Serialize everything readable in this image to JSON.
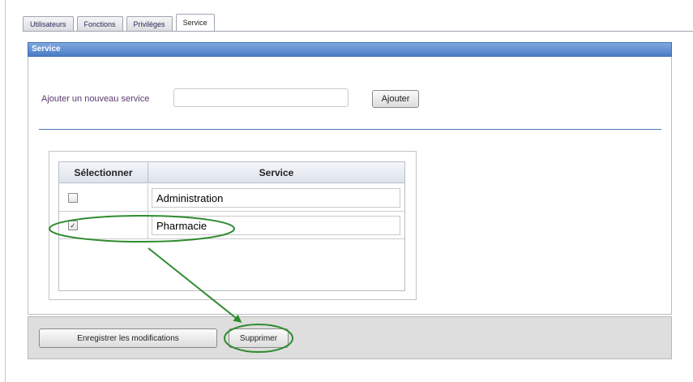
{
  "tabs": [
    {
      "label": "Utilisateurs",
      "active": false
    },
    {
      "label": "Fonctions",
      "active": false
    },
    {
      "label": "Privilèges",
      "active": false
    },
    {
      "label": "Service",
      "active": true
    }
  ],
  "panel": {
    "title": "Service",
    "add_label": "Ajouter un nouveau service",
    "add_input_value": "",
    "add_button": "Ajouter"
  },
  "grid": {
    "headers": [
      "Sélectionner",
      "Service"
    ],
    "rows": [
      {
        "checked": false,
        "service": "Administration"
      },
      {
        "checked": true,
        "service": "Pharmacie"
      }
    ]
  },
  "footer": {
    "save_button": "Enregistrer les modifications",
    "delete_button": "Supprimer"
  },
  "annotation": {
    "color": "#2e8b2e",
    "description_icon": "arrow-icon"
  },
  "colors": {
    "header_blue": "#4a7cc6",
    "divider_blue": "#4b78b8",
    "label_purple": "#5a3b72"
  }
}
